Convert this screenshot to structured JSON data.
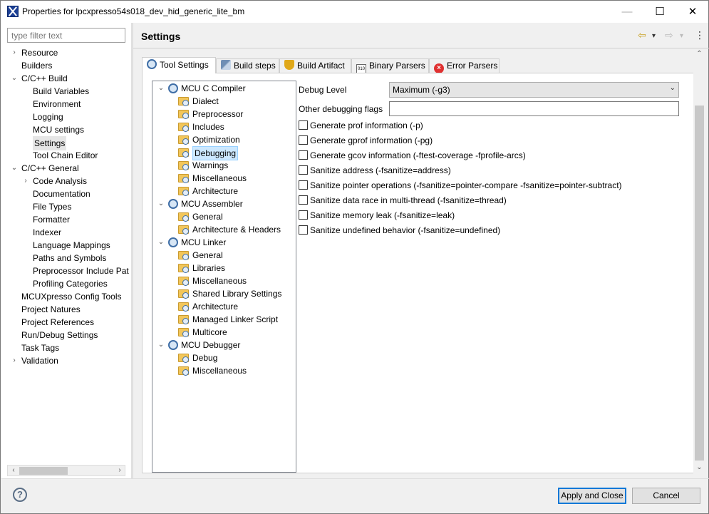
{
  "window": {
    "title": "Properties for lpcxpresso54s018_dev_hid_generic_lite_bm",
    "minimize": "—",
    "maximize": "☐",
    "close": "✕"
  },
  "filter": {
    "placeholder": "type filter text"
  },
  "nav": [
    {
      "label": "Resource",
      "expander": "›"
    },
    {
      "label": "Builders",
      "expander": ""
    },
    {
      "label": "C/C++ Build",
      "expander": "⌄"
    },
    {
      "label": "Build Variables",
      "expander": ""
    },
    {
      "label": "Environment",
      "expander": ""
    },
    {
      "label": "Logging",
      "expander": ""
    },
    {
      "label": "MCU settings",
      "expander": ""
    },
    {
      "label": "Settings",
      "expander": ""
    },
    {
      "label": "Tool Chain Editor",
      "expander": ""
    },
    {
      "label": "C/C++ General",
      "expander": "⌄"
    },
    {
      "label": "Code Analysis",
      "expander": "›"
    },
    {
      "label": "Documentation",
      "expander": ""
    },
    {
      "label": "File Types",
      "expander": ""
    },
    {
      "label": "Formatter",
      "expander": ""
    },
    {
      "label": "Indexer",
      "expander": ""
    },
    {
      "label": "Language Mappings",
      "expander": ""
    },
    {
      "label": "Paths and Symbols",
      "expander": ""
    },
    {
      "label": "Preprocessor Include Pat",
      "expander": ""
    },
    {
      "label": "Profiling Categories",
      "expander": ""
    },
    {
      "label": "MCUXpresso Config Tools",
      "expander": ""
    },
    {
      "label": "Project Natures",
      "expander": ""
    },
    {
      "label": "Project References",
      "expander": ""
    },
    {
      "label": "Run/Debug Settings",
      "expander": ""
    },
    {
      "label": "Task Tags",
      "expander": ""
    },
    {
      "label": "Validation",
      "expander": "›"
    }
  ],
  "header": {
    "title": "Settings",
    "back": "⇦",
    "forward": "⇨",
    "dropdown": "▾",
    "menu": "⋮"
  },
  "tabs": [
    {
      "label": "Tool Settings",
      "icon": "gear-icon"
    },
    {
      "label": "Build steps",
      "icon": "steps-icon"
    },
    {
      "label": "Build Artifact",
      "icon": "trophy-icon"
    },
    {
      "label": "Binary Parsers",
      "icon": "binary-icon"
    },
    {
      "label": "Error Parsers",
      "icon": "error-icon"
    }
  ],
  "tooltree": [
    {
      "label": "MCU C Compiler",
      "group": true
    },
    {
      "label": "Dialect"
    },
    {
      "label": "Preprocessor"
    },
    {
      "label": "Includes"
    },
    {
      "label": "Optimization"
    },
    {
      "label": "Debugging"
    },
    {
      "label": "Warnings"
    },
    {
      "label": "Miscellaneous"
    },
    {
      "label": "Architecture"
    },
    {
      "label": "MCU Assembler",
      "group": true
    },
    {
      "label": "General"
    },
    {
      "label": "Architecture & Headers"
    },
    {
      "label": "MCU Linker",
      "group": true
    },
    {
      "label": "General"
    },
    {
      "label": "Libraries"
    },
    {
      "label": "Miscellaneous"
    },
    {
      "label": "Shared Library Settings"
    },
    {
      "label": "Architecture"
    },
    {
      "label": "Managed Linker Script"
    },
    {
      "label": "Multicore"
    },
    {
      "label": "MCU Debugger",
      "group": true
    },
    {
      "label": "Debug"
    },
    {
      "label": "Miscellaneous"
    }
  ],
  "form": {
    "debug_level_label": "Debug Level",
    "debug_level_value": "Maximum (-g3)",
    "other_flags_label": "Other debugging flags",
    "other_flags_value": "",
    "checkboxes": [
      "Generate prof information (-p)",
      "Generate gprof information (-pg)",
      "Generate gcov information (-ftest-coverage -fprofile-arcs)",
      "Sanitize address (-fsanitize=address)",
      "Sanitize pointer operations (-fsanitize=pointer-compare -fsanitize=pointer-subtract)",
      "Sanitize data race in multi-thread (-fsanitize=thread)",
      "Sanitize memory leak (-fsanitize=leak)",
      "Sanitize undefined behavior (-fsanitize=undefined)"
    ]
  },
  "buttons": {
    "help": "?",
    "apply_close": "Apply and Close",
    "cancel": "Cancel"
  }
}
